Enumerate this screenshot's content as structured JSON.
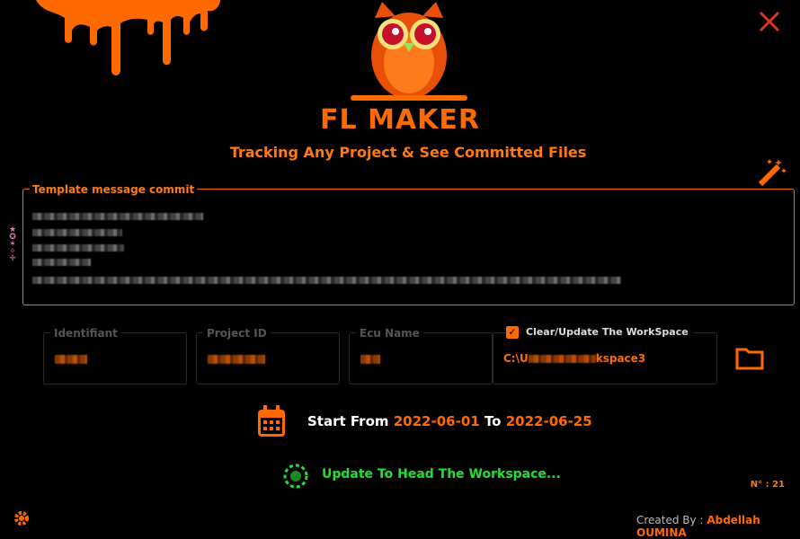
{
  "app": {
    "brand": "FL MAKER",
    "subtitle": "Tracking Any Project & See Committed Files"
  },
  "template": {
    "label": "Template message commit",
    "counter": "N° : 21"
  },
  "fields": [
    {
      "label": "Identifiant"
    },
    {
      "label": "Project ID"
    },
    {
      "label": "Ecu Name"
    }
  ],
  "workspace": {
    "checkbox_label": "Clear/Update The WorkSpace",
    "checked": true,
    "path_start": "C:\\U",
    "path_end": "kspace3"
  },
  "dates": {
    "prefix": "Start From",
    "from": "2022-06-01",
    "mid": "To",
    "to": "2022-06-25"
  },
  "status": {
    "text": "Update To Head The Workspace..."
  },
  "footer": {
    "created_by": "Created By : ",
    "author": "Abdellah OUMINA"
  },
  "colors": {
    "accent": "#ff6a00",
    "status": "#22e030"
  }
}
